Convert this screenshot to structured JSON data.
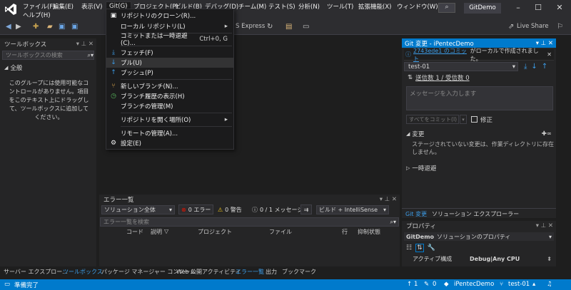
{
  "menu": {
    "items": [
      "ファイル(F)",
      "編集(E)",
      "表示(V)",
      "Git(G)",
      "プロジェクト(P)",
      "ビルド(B)",
      "デバッグ(D)",
      "チーム(M)",
      "テスト(S)",
      "分析(N)",
      "ツール(T)",
      "拡張機能(X)",
      "ウィンドウ(W)"
    ],
    "help": "ヘルプ(H)",
    "solution_name": "GitDemo"
  },
  "toolbar": {
    "config_text": "S Express",
    "live_share": "Live Share"
  },
  "git_menu": {
    "items": [
      {
        "label": "リポジトリのクローン(R)...",
        "shortcut": "",
        "icon": "clone-icon"
      },
      {
        "label": "ローカル リポジトリ(L)",
        "shortcut": "",
        "icon": ""
      },
      {
        "label": "コミットまたは一時退避(C)...",
        "shortcut": "Ctrl+0, G",
        "icon": ""
      },
      {
        "label": "フェッチ(F)",
        "shortcut": "",
        "icon": "fetch-icon"
      },
      {
        "label": "プル(U)",
        "shortcut": "",
        "icon": "pull-icon"
      },
      {
        "label": "プッシュ(P)",
        "shortcut": "",
        "icon": "push-icon"
      },
      {
        "label": "新しいブランチ(N)...",
        "shortcut": "",
        "icon": "new-branch-icon"
      },
      {
        "label": "ブランチ履歴の表示(H)",
        "shortcut": "",
        "icon": "history-icon"
      },
      {
        "label": "ブランチの管理(M)",
        "shortcut": "",
        "icon": ""
      },
      {
        "label": "リポジトリを開く場所(O)",
        "shortcut": "",
        "icon": ""
      },
      {
        "label": "リモートの管理(A)...",
        "shortcut": "",
        "icon": ""
      },
      {
        "label": "設定(E)",
        "shortcut": "",
        "icon": "gear-icon"
      }
    ]
  },
  "toolbox": {
    "title": "ツールボックス",
    "search_placeholder": "ツールボックスの検索",
    "group": "全般",
    "empty_message": "このグループには使用可能なコントロールがありません。項目をこのテキスト上にドラッグして、ツールボックスに追加してください。"
  },
  "git_changes": {
    "title": "Git 変更 - iPentecDemo",
    "banner_link": "2743ede1 のコミット",
    "banner_text": "がローカルで作成されました。",
    "branch": "test-01",
    "sync_link": "送信数 1 / 受信数 0",
    "message_placeholder": "メッセージを入力します",
    "commit_all": "すべてをコミット(I)",
    "amend": "修正",
    "changes_header": "変更",
    "changes_empty": "ステージされていない変更は、作業ディレクトリに存在しません。",
    "stash_header": "一時退避"
  },
  "right_tabs": [
    "Git 変更",
    "ソリューション エクスプローラー"
  ],
  "error_list": {
    "title": "エラー一覧",
    "scope": "ソリューション全体",
    "errors": "0 エラー",
    "warnings": "0 警告",
    "messages": "0 / 1 メッセージ",
    "build_filter": "ビルド + IntelliSense",
    "search_placeholder": "エラー一覧を検索",
    "columns": [
      "コード",
      "説明",
      "プロジェクト",
      "ファイル",
      "行",
      "抑制状態"
    ]
  },
  "properties": {
    "title": "プロパティ",
    "object": "GitDemo",
    "object_desc": "ソリューションのプロパティ",
    "row_label": "アクティブ構成",
    "row_value": "Debug|Any CPU"
  },
  "bottom_tabs_left": [
    "サーバー エクスプロー...",
    "ツールボックス"
  ],
  "bottom_tabs_center": [
    "パッケージ マネージャー コンソール",
    "Web 公開アクティビティ",
    "エラー一覧",
    "出力",
    "ブックマーク"
  ],
  "status": {
    "ready": "準備完了",
    "up": "1",
    "pencil": "0",
    "repo": "iPentecDemo",
    "branch": "test-01"
  },
  "colors": {
    "accent": "#007acc",
    "background": "#1e1e1e",
    "panel": "#252526"
  }
}
